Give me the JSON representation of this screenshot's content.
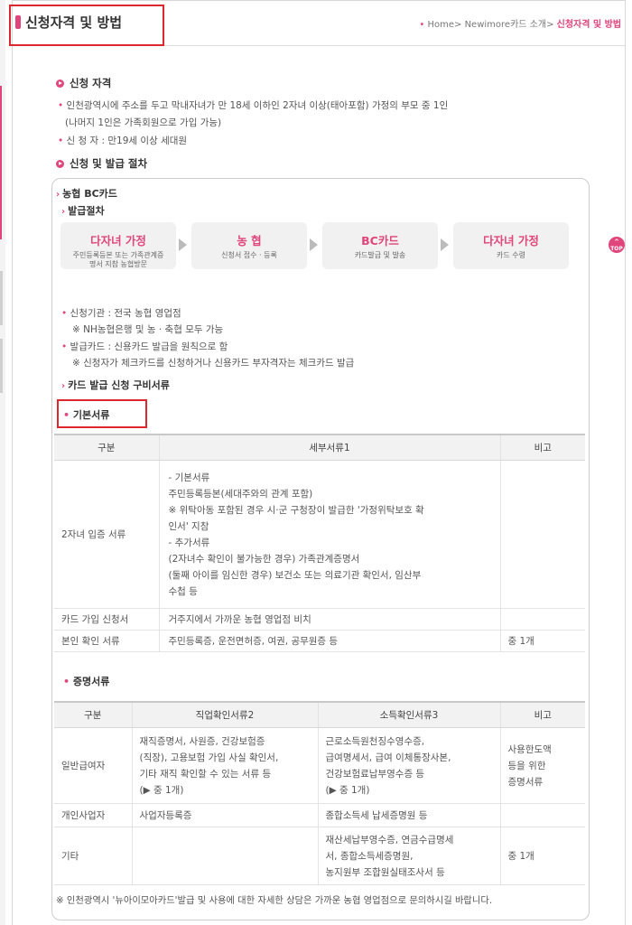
{
  "header": {
    "title": "신청자격 및 방법",
    "breadcrumb": {
      "home": "Home",
      "parent": "Newimore카드 소개",
      "current": "신청자격 및 방법"
    }
  },
  "eligibility": {
    "heading": "신청 자격",
    "line1": "인천광역시에 주소를 두고 막내자녀가 만 18세 이하인 2자녀 이상(태아포함) 가정의 부모 중 1인",
    "line2": "(나머지 1인은 가족회원으로 가입 가능)",
    "line3": "신 청 자 : 만19세 이상 세대원"
  },
  "procedure": {
    "heading": "신청 및 발급 절차",
    "card_type": "농협 BC카드",
    "issue_label": "발급절차",
    "steps": [
      {
        "title": "다자녀 가정",
        "sub": "주민등록등본 또는 가족관계증명서 지참 농협방문"
      },
      {
        "title": "농 협",
        "sub": "신청서 접수 · 등록"
      },
      {
        "title": "BC카드",
        "sub": "카드발급 및 발송"
      },
      {
        "title": "다자녀 가정",
        "sub": "카드 수령"
      }
    ],
    "info1": "신청기관 : 전국 농협 영업점",
    "info2": "※ NH농협은행 및 농 · 축협 모두 가능",
    "info3": "발급카드 : 신용카드 발급을 원칙으로 함",
    "info4": "※ 신청자가 체크카드를 신청하거나 신용카드 부자격자는 체크카드 발급",
    "docs_label": "카드 발급 신청 구비서류"
  },
  "basic_docs": {
    "label": "기본서류",
    "headers": [
      "구분",
      "세부서류1",
      "비고"
    ],
    "rows": [
      {
        "col1": "2자녀 입증 서류",
        "col2": "- 기본서류\n  주민등록등본(세대주와의 관계 포함)\n  ※ 위탁아동 포함된 경우 시·군 구청장이 발급한 '가정위탁보호 확\n  인서' 지참\n- 추가서류\n  (2자녀수 확인이 불가능한 경우) 가족관계증명서\n  (둘째 아이를 임신한 경우) 보건소 또는 의료기관 확인서, 임산부\n  수첩 등",
        "col3": ""
      },
      {
        "col1": "카드 가입 신청서",
        "col2": "거주지에서 가까운 농협 영업점 비치",
        "col3": ""
      },
      {
        "col1": "본인 확인 서류",
        "col2": "주민등록증, 운전면허증, 여권, 공무원증 등",
        "col3": "중 1개"
      }
    ]
  },
  "proof_docs": {
    "label": "증명서류",
    "headers": [
      "구분",
      "직업확인서류2",
      "소득확인서류3",
      "비고"
    ],
    "rows": [
      {
        "col1": "일반급여자",
        "col2": "재직증명서, 사원증, 건강보험증\n(직장), 고용보험 가입 사실 확인서,\n기타 재직 확인할 수 있는 서류 등\n(▶ 중 1개)",
        "col3": "근로소득원천징수영수증,\n급여명세서, 급여 이체통장사본,\n건강보험료납부영수증 등\n(▶ 중 1개)",
        "col4": "사용한도액\n등을 위한\n증명서류"
      },
      {
        "col1": "개인사업자",
        "col2": "사업자등록증",
        "col3": "종합소득세 납세증명원 등",
        "col4": ""
      },
      {
        "col1": "기타",
        "col2": "",
        "col3": "재산세납부영수증, 연금수급명세\n서, 종합소득세증명원,\n농지원부 조합원실태조사서 등",
        "col4": "중 1개"
      }
    ]
  },
  "note": "※ 인천광역시 '뉴아이모아카드'발급 및 사용에 대한 자세한 상담은 가까운 농협 영업점으로 문의하시길 바랍니다.",
  "top_button": "TOP",
  "colors": {
    "accent": "#e0457b",
    "highlight_border": "#e0272f"
  }
}
